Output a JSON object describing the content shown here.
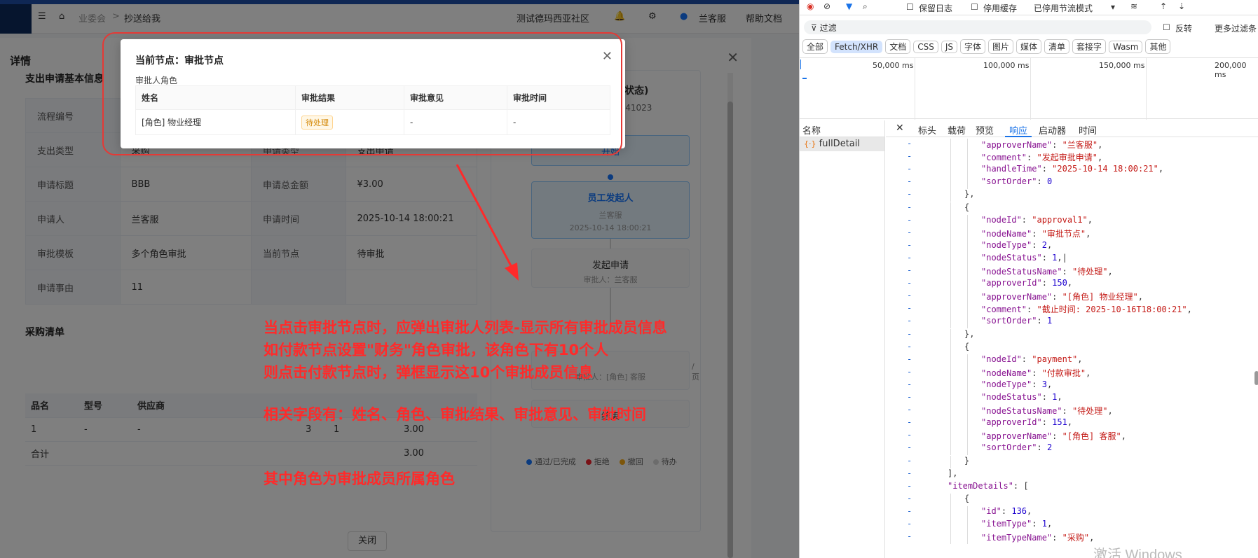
{
  "app": {
    "breadcrumb": [
      "业委会",
      "抄送给我"
    ],
    "community": "测试德玛西亚社区",
    "user": "兰客服",
    "help": "帮助文档"
  },
  "detail": {
    "title": "详情",
    "basic_section": "支出申请基本信息",
    "rows": [
      {
        "l1": "流程编号",
        "v1": "",
        "l2": "",
        "v2": ""
      },
      {
        "l1": "支出类型",
        "v1": "采购",
        "l2": "申请类型",
        "v2": "支出申请"
      },
      {
        "l1": "申请标题",
        "v1": "BBB",
        "l2": "申请总金额",
        "v2": "¥3.00"
      },
      {
        "l1": "申请人",
        "v1": "兰客服",
        "l2": "申请时间",
        "v2": "2025-10-14 18:00:21"
      },
      {
        "l1": "审批模板",
        "v1": "多个角色审批",
        "l2": "当前节点",
        "v2": "待审批"
      },
      {
        "l1": "申请事由",
        "v1": "11",
        "l2": "",
        "v2": ""
      }
    ],
    "items_section": "采购清单",
    "item_headers": [
      "品名",
      "型号",
      "供应商",
      "",
      "",
      "",
      ""
    ],
    "item_rows": [
      [
        "1",
        "-",
        "-",
        "",
        "3",
        "1",
        "3.00"
      ],
      [
        "合计",
        "",
        "",
        "",
        "",
        "",
        "3.00"
      ]
    ],
    "close_label": "关闭"
  },
  "flow": {
    "header_fragment": "程状态)",
    "id_fragment": "0141023",
    "start": "开始",
    "node_employee": "员工发起人",
    "node_employee_user": "兰客服",
    "node_employee_time": "2025-10-14 18:00:21",
    "node_submit": "发起申请",
    "node_submit_user": "审批人：兰客服",
    "node_pay_fragment": "审批人：[角色] 客服",
    "end": "结束",
    "page_size_fragment": "/页",
    "legend": [
      {
        "label": "通过/已完成",
        "color": "#1677ff"
      },
      {
        "label": "拒绝",
        "color": "#f5222d"
      },
      {
        "label": "撤回",
        "color": "#faad14"
      },
      {
        "label": "待办",
        "color": "#d9d9d9"
      }
    ]
  },
  "popup": {
    "title": "当前节点：审批节点",
    "subtitle": "审批人角色",
    "headers": [
      "姓名",
      "审批结果",
      "审批意见",
      "审批时间"
    ],
    "rows": [
      {
        "name": "[角色] 物业经理",
        "result": "待处理",
        "comment": "-",
        "time": "-"
      }
    ]
  },
  "annotation": {
    "line1": "当点击审批节点时，应弹出审批人列表-显示所有审批成员信息",
    "line2": "如付款节点设置\"财务\"角色审批，该角色下有10个人",
    "line3": "则点击付款节点时，弹框显示这10个审批成员信息",
    "line4": "相关字段有：姓名、角色、审批结果、审批意见、审批时间",
    "line5": "其中角色为审批成员所属角色"
  },
  "devtools": {
    "preserve_log": "保留日志",
    "disable_cache": "停用缓存",
    "throttle": "已停用节流模式",
    "filter_placeholder": "过滤",
    "invert": "反转",
    "more_filters": "更多过滤条",
    "types": [
      "全部",
      "Fetch/XHR",
      "文档",
      "CSS",
      "JS",
      "字体",
      "图片",
      "媒体",
      "清单",
      "套接字",
      "Wasm",
      "其他"
    ],
    "active_type": "Fetch/XHR",
    "timeline": [
      "50,000 ms",
      "100,000 ms",
      "150,000 ms",
      "200,000 ms"
    ],
    "names_header": "名称",
    "request_name": "fullDetail",
    "tabs": [
      "标头",
      "载荷",
      "预览",
      "响应",
      "启动器",
      "时间"
    ],
    "active_tab": "响应",
    "watermark": "激活 Windows"
  },
  "code_lines": [
    {
      "indent": 5,
      "k": "\"approverName\"",
      "v": "\"兰客服\"",
      "t": "s",
      "end": ","
    },
    {
      "indent": 5,
      "k": "\"comment\"",
      "v": "\"发起审批申请\"",
      "t": "s",
      "end": ","
    },
    {
      "indent": 5,
      "k": "\"handleTime\"",
      "v": "\"2025-10-14 18:00:21\"",
      "t": "s",
      "end": ","
    },
    {
      "indent": 5,
      "k": "\"sortOrder\"",
      "v": "0",
      "t": "n",
      "end": ""
    },
    {
      "indent": 4,
      "raw": "},"
    },
    {
      "indent": 4,
      "raw": "{"
    },
    {
      "indent": 5,
      "k": "\"nodeId\"",
      "v": "\"approval1\"",
      "t": "s",
      "end": ","
    },
    {
      "indent": 5,
      "k": "\"nodeName\"",
      "v": "\"审批节点\"",
      "t": "s",
      "end": ","
    },
    {
      "indent": 5,
      "k": "\"nodeType\"",
      "v": "2",
      "t": "n",
      "end": ","
    },
    {
      "indent": 5,
      "k": "\"nodeStatus\"",
      "v": "1",
      "t": "n",
      "end": ",|"
    },
    {
      "indent": 5,
      "k": "\"nodeStatusName\"",
      "v": "\"待处理\"",
      "t": "s",
      "end": ","
    },
    {
      "indent": 5,
      "k": "\"approverId\"",
      "v": "150",
      "t": "n",
      "end": ","
    },
    {
      "indent": 5,
      "k": "\"approverName\"",
      "v": "\"[角色] 物业经理\"",
      "t": "s",
      "end": ","
    },
    {
      "indent": 5,
      "k": "\"comment\"",
      "v": "\"截止时间: 2025-10-16T18:00:21\"",
      "t": "s",
      "end": ","
    },
    {
      "indent": 5,
      "k": "\"sortOrder\"",
      "v": "1",
      "t": "n",
      "end": ""
    },
    {
      "indent": 4,
      "raw": "},"
    },
    {
      "indent": 4,
      "raw": "{"
    },
    {
      "indent": 5,
      "k": "\"nodeId\"",
      "v": "\"payment\"",
      "t": "s",
      "end": ","
    },
    {
      "indent": 5,
      "k": "\"nodeName\"",
      "v": "\"付款审批\"",
      "t": "s",
      "end": ","
    },
    {
      "indent": 5,
      "k": "\"nodeType\"",
      "v": "3",
      "t": "n",
      "end": ","
    },
    {
      "indent": 5,
      "k": "\"nodeStatus\"",
      "v": "1",
      "t": "n",
      "end": ","
    },
    {
      "indent": 5,
      "k": "\"nodeStatusName\"",
      "v": "\"待处理\"",
      "t": "s",
      "end": ","
    },
    {
      "indent": 5,
      "k": "\"approverId\"",
      "v": "151",
      "t": "n",
      "end": ","
    },
    {
      "indent": 5,
      "k": "\"approverName\"",
      "v": "\"[角色] 客服\"",
      "t": "s",
      "end": ","
    },
    {
      "indent": 5,
      "k": "\"sortOrder\"",
      "v": "2",
      "t": "n",
      "end": ""
    },
    {
      "indent": 4,
      "raw": "}"
    },
    {
      "indent": 3,
      "raw": "],"
    },
    {
      "indent": 3,
      "k": "\"itemDetails\"",
      "v": "[",
      "t": "p",
      "end": ""
    },
    {
      "indent": 4,
      "raw": "{"
    },
    {
      "indent": 5,
      "k": "\"id\"",
      "v": "136",
      "t": "n",
      "end": ","
    },
    {
      "indent": 5,
      "k": "\"itemType\"",
      "v": "1",
      "t": "n",
      "end": ","
    },
    {
      "indent": 5,
      "k": "\"itemTypeName\"",
      "v": "\"采购\"",
      "t": "s",
      "end": ","
    }
  ]
}
